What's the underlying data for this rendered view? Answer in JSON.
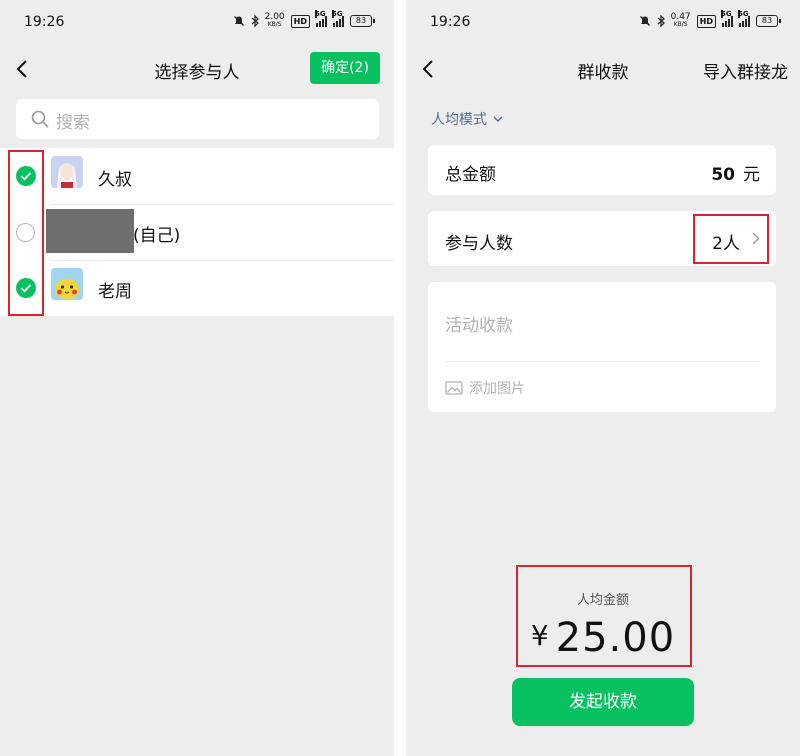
{
  "left": {
    "status": {
      "time": "19:26",
      "speed_top": "2.00",
      "speed_bottom": "KB/S",
      "hd": "HD",
      "sig1": "5G",
      "sig2": "5G",
      "battery": "83"
    },
    "title": "选择参与人",
    "confirm_label": "确定(2)",
    "search_placeholder": "搜索",
    "contacts": [
      {
        "name": "久叔",
        "checked": true
      },
      {
        "name": "(自己)",
        "checked": false
      },
      {
        "name": "老周",
        "checked": true
      }
    ]
  },
  "right": {
    "status": {
      "time": "19:26",
      "speed_top": "0.47",
      "speed_bottom": "KB/S",
      "hd": "HD",
      "sig1": "5G",
      "sig2": "5G",
      "battery": "83"
    },
    "title": "群收款",
    "import_label": "导入群接龙",
    "mode_label": "人均模式",
    "total_label": "总金额",
    "total_value": "50",
    "total_unit": "元",
    "participants_label": "参与人数",
    "participants_value": "2人",
    "note_placeholder": "活动收款",
    "add_image_label": "添加图片",
    "per_person_label": "人均金额",
    "per_person_currency": "¥",
    "per_person_value": "25.00",
    "submit_label": "发起收款"
  },
  "colors": {
    "accent": "#07c160",
    "link": "#576b95",
    "highlight": "#d9232d",
    "background": "#ededed"
  }
}
